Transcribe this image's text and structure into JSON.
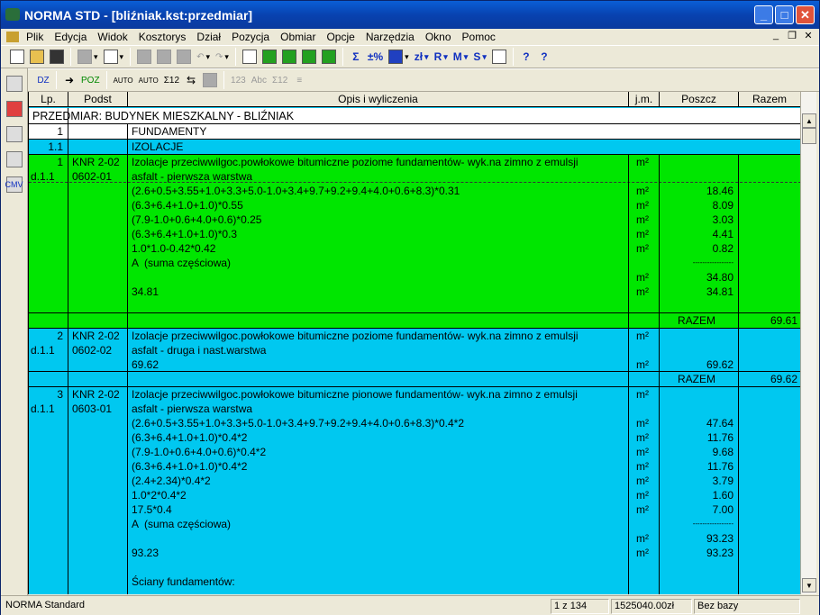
{
  "window": {
    "title": "NORMA STD - [bliźniak.kst:przedmiar]",
    "minimize_label": "_",
    "maximize_label": "□",
    "close_label": "✕"
  },
  "menu": {
    "items": [
      "Plik",
      "Edycja",
      "Widok",
      "Kosztorys",
      "Dział",
      "Pozycja",
      "Obmiar",
      "Opcje",
      "Narzędzia",
      "Okno",
      "Pomoc"
    ],
    "mdi_minimize": "_",
    "mdi_restore": "❐",
    "mdi_close": "✕"
  },
  "toolbar1": {
    "sigma_label": "Σ",
    "percent_label": "±%",
    "zl_label": "zł",
    "r_label": "R",
    "m_label": "M",
    "s_label": "S",
    "help_label": "?",
    "help_cursor_label": "?"
  },
  "toolbar2": {
    "dz_label": "DZ",
    "poz_label": "POZ",
    "auto1_label": "AUTO",
    "auto2_label": "AUTO",
    "sigma12_label": "Σ12",
    "n123_label": "123",
    "abc_label": "Abc",
    "sigma12b_label": "Σ12"
  },
  "grid": {
    "columns": [
      "Lp.",
      "Podst",
      "Opis i wyliczenia",
      "j.m.",
      "Poszcz",
      "Razem"
    ],
    "title_row": "PRZEDMIAR: BUDYNEK MIESZKALNY - BLIŹNIAK",
    "section1_lp": "1",
    "section1_name": "FUNDAMENTY",
    "section11_lp": "1.1",
    "section11_name": "IZOLACJE",
    "pos1": {
      "lp": "1",
      "d": "d.1.1",
      "podst1": "KNR 2-02",
      "podst2": "0602-01",
      "opis1": "Izolacje przeciwwilgoc.powłokowe bitumiczne poziome fundamentów- wyk.na zimno z emulsji",
      "opis2": "asfalt - pierwsza warstwa",
      "jm": "m²",
      "lines": [
        {
          "expr": "(2.6+0.5+3.55+1.0+3.3+5.0-1.0+3.4+9.7+9.2+9.4+4.0+0.6+8.3)*0.31",
          "jm": "m²",
          "val": "18.46"
        },
        {
          "expr": "(6.3+6.4+1.0+1.0)*0.55",
          "jm": "m²",
          "val": "8.09"
        },
        {
          "expr": "(7.9-1.0+0.6+4.0+0.6)*0.25",
          "jm": "m²",
          "val": "3.03"
        },
        {
          "expr": "(6.3+6.4+1.0+1.0)*0.3",
          "jm": "m²",
          "val": "4.41"
        },
        {
          "expr": "1.0*1.0-0.42*0.42",
          "jm": "m²",
          "val": "0.82"
        }
      ],
      "subtotal_label": "A  (suma częściowa)",
      "dashes": "-----------------",
      "subtotal_jm": "m²",
      "subtotal_val": "34.80",
      "final_expr": "34.81",
      "final_jm": "m²",
      "final_val": "34.81",
      "razem_label": "RAZEM",
      "razem_val": "69.61"
    },
    "pos2": {
      "lp": "2",
      "d": "d.1.1",
      "podst1": "KNR 2-02",
      "podst2": "0602-02",
      "opis1": "Izolacje przeciwwilgoc.powłokowe bitumiczne poziome fundamentów- wyk.na zimno z emulsji",
      "opis2": "asfalt - druga i nast.warstwa",
      "jm": "m²",
      "expr": "69.62",
      "expr_jm": "m²",
      "expr_val": "69.62",
      "razem_label": "RAZEM",
      "razem_val": "69.62"
    },
    "pos3": {
      "lp": "3",
      "d": "d.1.1",
      "podst1": "KNR 2-02",
      "podst2": "0603-01",
      "opis1": "Izolacje przeciwwilgoc.powłokowe bitumiczne pionowe fundamentów- wyk.na zimno z emulsji",
      "opis2": "asfalt - pierwsza warstwa",
      "jm": "m²",
      "lines": [
        {
          "expr": "(2.6+0.5+3.55+1.0+3.3+5.0-1.0+3.4+9.7+9.2+9.4+4.0+0.6+8.3)*0.4*2",
          "jm": "m²",
          "val": "47.64"
        },
        {
          "expr": "(6.3+6.4+1.0+1.0)*0.4*2",
          "jm": "m²",
          "val": "11.76"
        },
        {
          "expr": "(7.9-1.0+0.6+4.0+0.6)*0.4*2",
          "jm": "m²",
          "val": "9.68"
        },
        {
          "expr": "(6.3+6.4+1.0+1.0)*0.4*2",
          "jm": "m²",
          "val": "11.76"
        },
        {
          "expr": "(2.4+2.34)*0.4*2",
          "jm": "m²",
          "val": "3.79"
        },
        {
          "expr": "1.0*2*0.4*2",
          "jm": "m²",
          "val": "1.60"
        },
        {
          "expr": "17.5*0.4",
          "jm": "m²",
          "val": "7.00"
        }
      ],
      "subtotal_label": "A  (suma częściowa)",
      "dashes": "-----------------",
      "subtotal_jm": "m²",
      "subtotal_val": "93.23",
      "final_expr": "93.23",
      "final_jm": "m²",
      "final_val": "93.23",
      "walls_label": "Ściany fundamentów:"
    }
  },
  "status": {
    "app": "NORMA Standard",
    "page": "1 z 134",
    "total": "1525040.00zł",
    "base": "Bez bazy"
  },
  "colors": {
    "green": "#00e600",
    "cyan": "#00c8f0",
    "title_blue": "#0842b0"
  }
}
